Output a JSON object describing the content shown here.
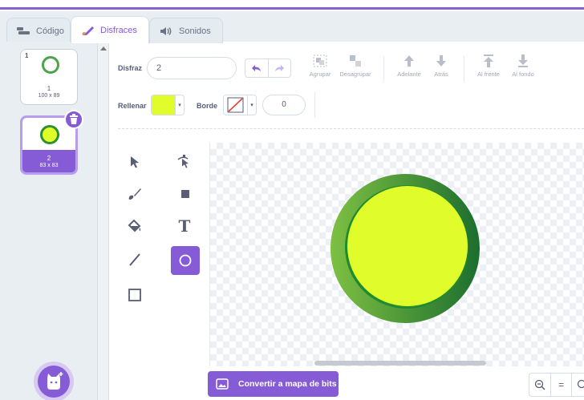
{
  "tabs": [
    {
      "label": "Código",
      "icon": "code-icon"
    },
    {
      "label": "Disfraces",
      "icon": "brush-icon",
      "active": true
    },
    {
      "label": "Sonidos",
      "icon": "speaker-icon"
    }
  ],
  "costumes": [
    {
      "num": "1",
      "name": "1",
      "size": "100 x 89",
      "thumb_fill": "#ffffff",
      "thumb_ring": "#4aa54a"
    },
    {
      "num": "2",
      "name": "2",
      "size": "83 x 83",
      "thumb_fill": "#e1fc2b",
      "thumb_ring": "#2f8f2f",
      "selected": true
    }
  ],
  "toolbar": {
    "costume_label": "Disfraz",
    "costume_name": "2",
    "group": "Agrupar",
    "ungroup": "Desagrupar",
    "forward": "Adelante",
    "backward": "Atrás",
    "front": "Al frente",
    "back": "Al fondo",
    "fill_label": "Rellenar",
    "fill_color": "#e1fc2b",
    "outline_label": "Borde",
    "outline_width": "0"
  },
  "tools": [
    {
      "name": "select",
      "icon": "select-arrow-icon"
    },
    {
      "name": "reshape",
      "icon": "reshape-icon"
    },
    {
      "name": "brush",
      "icon": "brush-icon"
    },
    {
      "name": "eraser",
      "icon": "eraser-icon"
    },
    {
      "name": "fill",
      "icon": "fill-bucket-icon"
    },
    {
      "name": "text",
      "icon": "text-icon",
      "glyph": "T"
    },
    {
      "name": "line",
      "icon": "line-icon"
    },
    {
      "name": "circle",
      "icon": "circle-icon",
      "selected": true
    },
    {
      "name": "rectangle",
      "icon": "rectangle-icon"
    }
  ],
  "canvas": {
    "shape_outer_colors": [
      "#7ec043",
      "#1c6e2e"
    ],
    "shape_inner_color": "#e1fc2b"
  },
  "bottom": {
    "bitmap_button": "Convertir a mapa de bits",
    "zoom_out": "−",
    "zoom_reset": "="
  },
  "colors": {
    "accent": "#855cd6",
    "text": "#575e75"
  }
}
